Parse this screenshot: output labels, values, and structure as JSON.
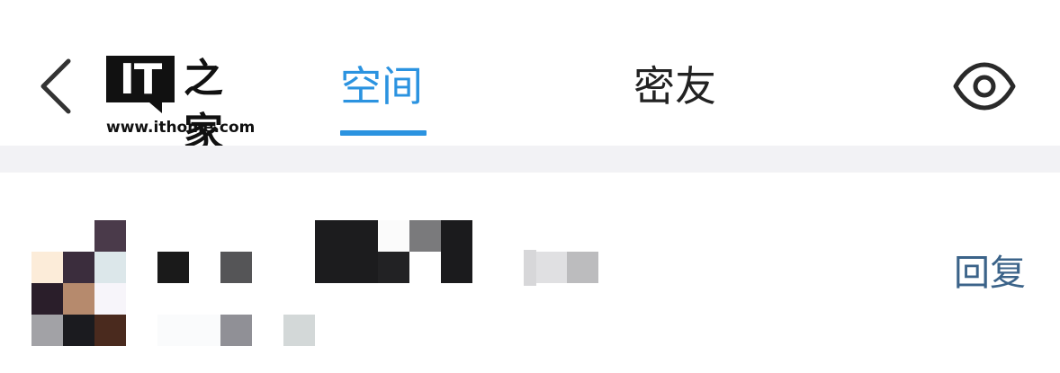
{
  "header": {
    "back_icon": "chevron-left-icon",
    "logo": {
      "brand_text": "IT之家",
      "url": "www.ithome.com"
    },
    "tabs": [
      {
        "label": "空间",
        "active": true
      },
      {
        "label": "密友",
        "active": false
      }
    ],
    "eye_icon": "eye-icon",
    "accent_color": "#2b93e0"
  },
  "comment": {
    "reply_label": "回复",
    "reply_color": "#3b6389"
  }
}
